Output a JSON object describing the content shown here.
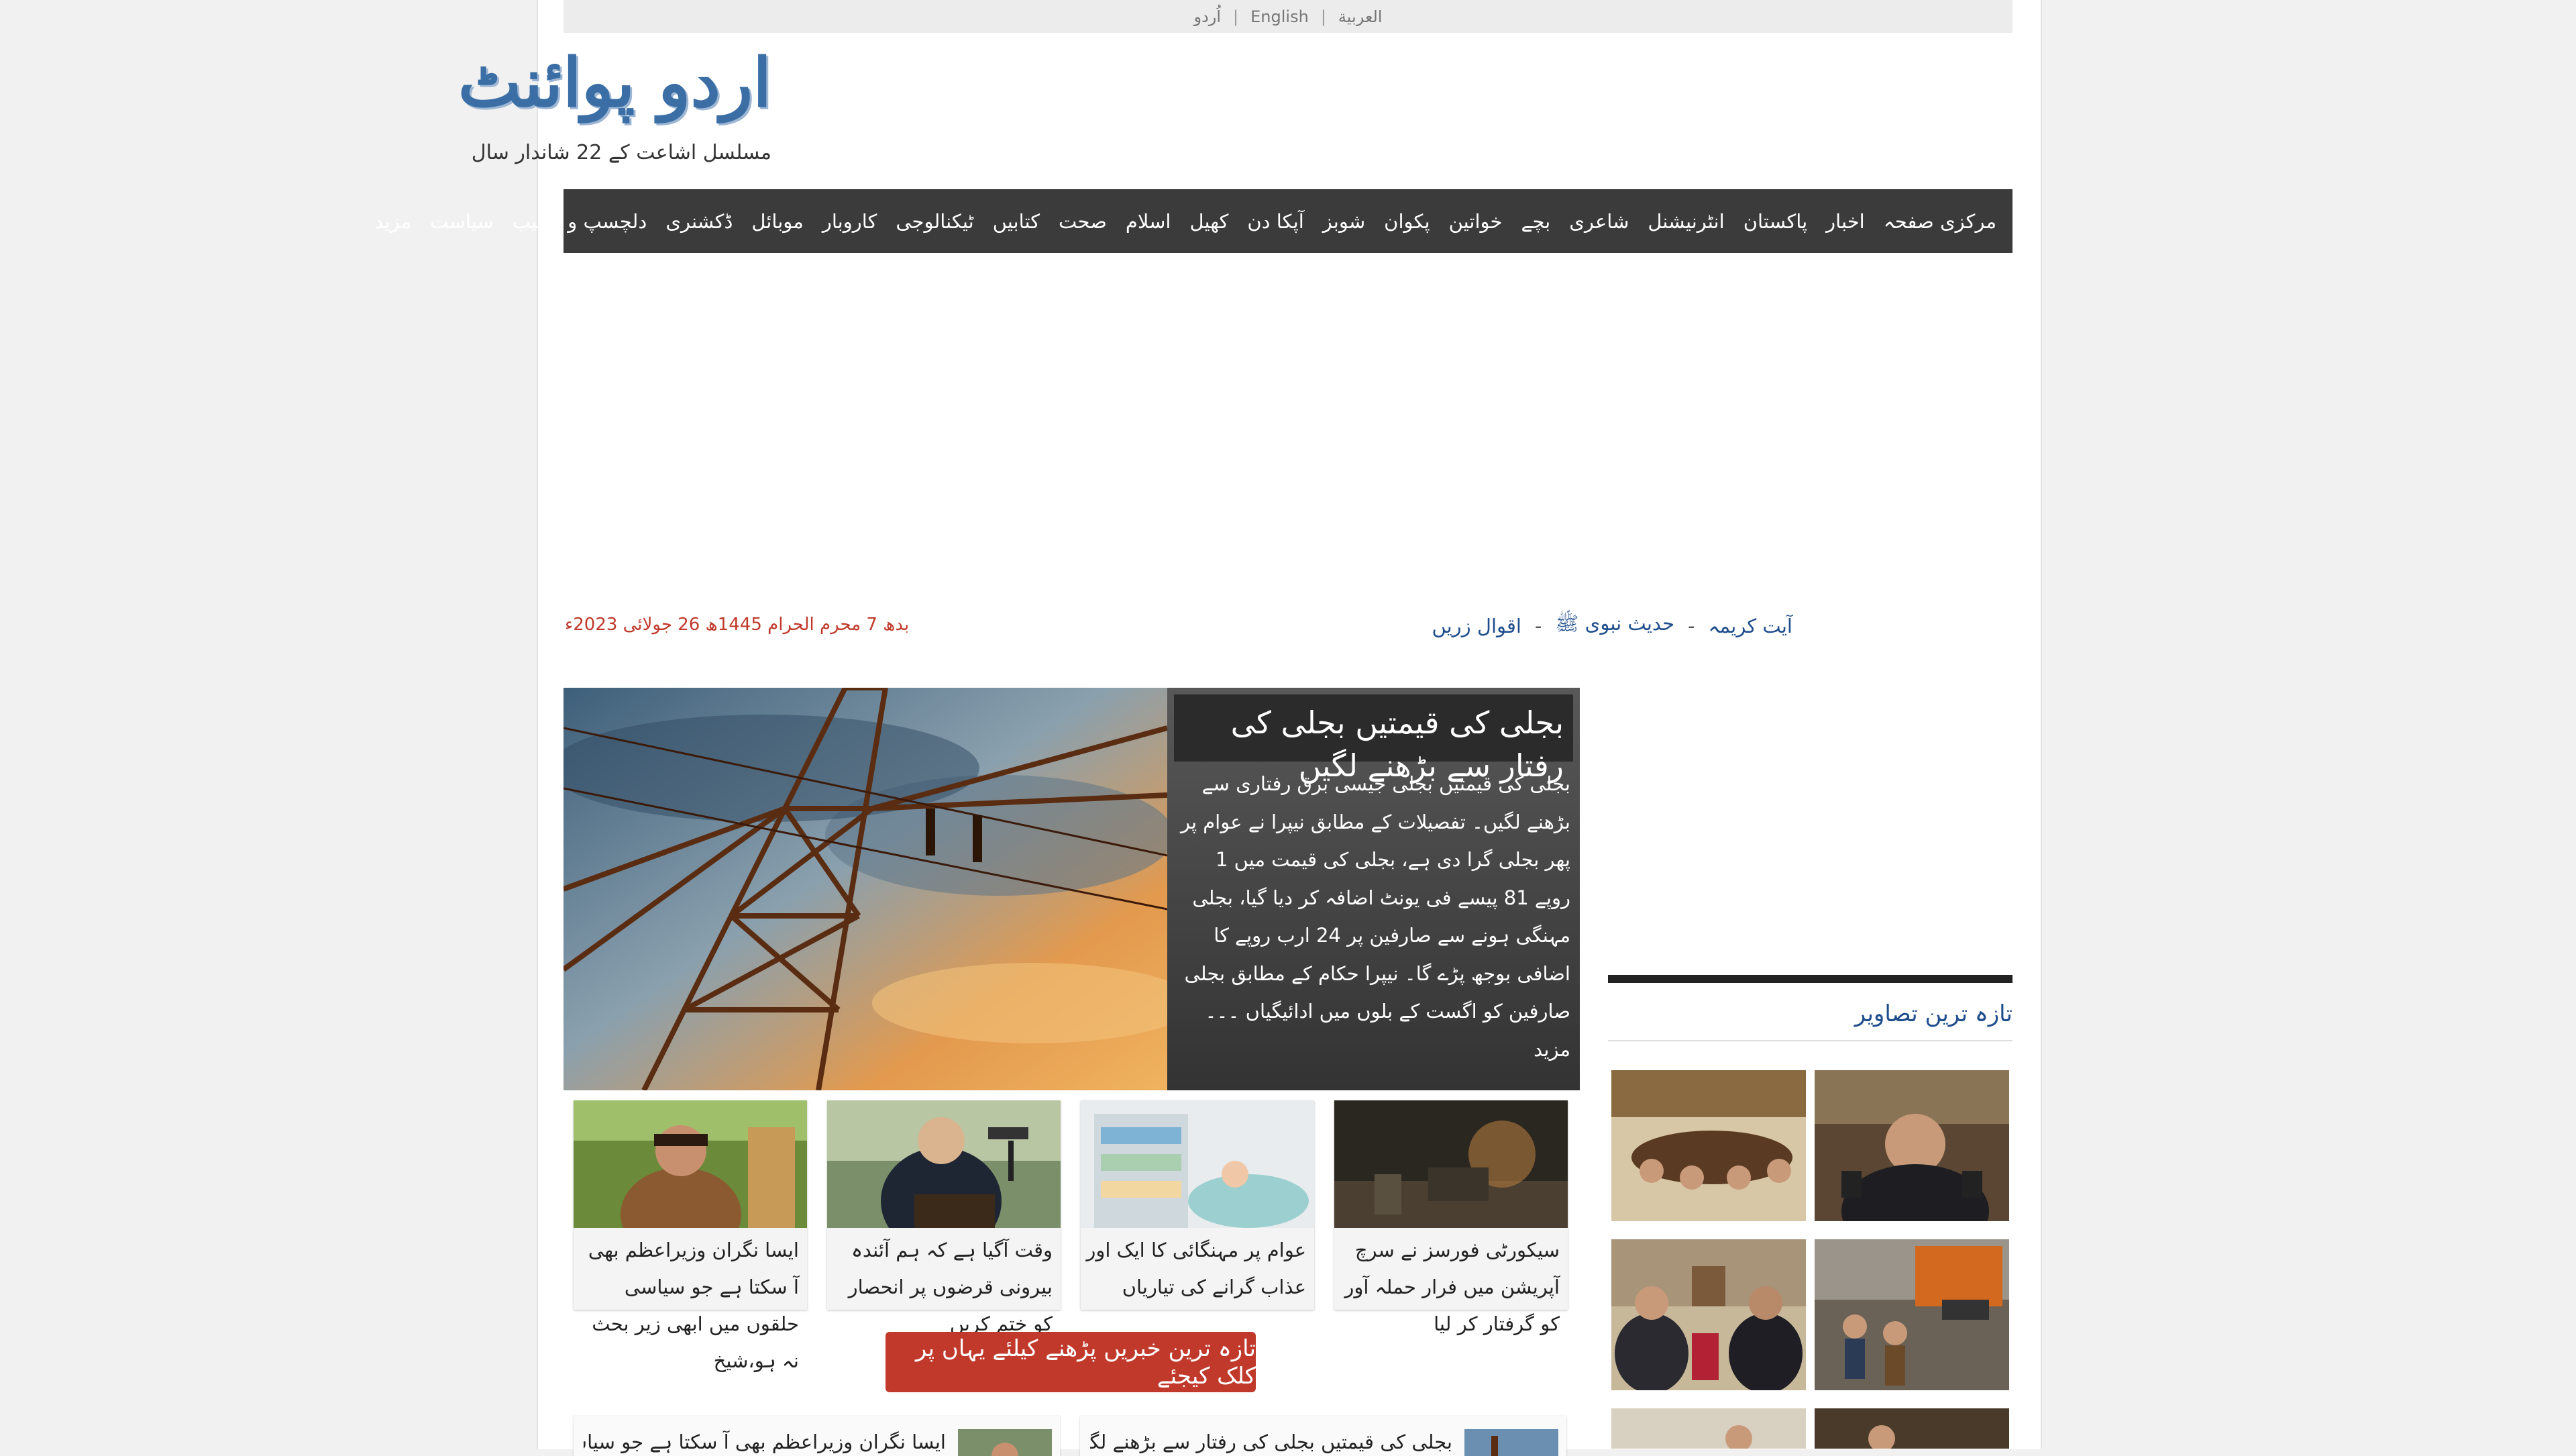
{
  "lang_bar": {
    "urdu": "اُردو",
    "english": "English",
    "arabic": "العربية",
    "sep": "|"
  },
  "logo": {
    "name": "اردو پوائنٹ",
    "tagline": "مسلسل اشاعت کے 22 شاندار سال"
  },
  "nav": {
    "items": [
      "مرکزی صفحہ",
      "اخبار",
      "پاکستان",
      "انٹرنیشنل",
      "شاعری",
      "بچے",
      "خواتین",
      "پکوان",
      "شوبز",
      "آپکا دن",
      "کھیل",
      "اسلام",
      "صحت",
      "کتابیں",
      "ٹیکنالوجی",
      "کاروبار",
      "موبائل",
      "ڈکشنری",
      "دلچسپ و عجیب",
      "سیاست",
      "مزید"
    ]
  },
  "subnav": {
    "items": [
      "آیت کریمہ",
      "حدیث نبوی ﷺ",
      "اقوال زریں"
    ],
    "sep": "-"
  },
  "date": "بدھ 7 محرم الحرام 1445ھ 26 جولائی 2023ء",
  "hero": {
    "title": "بجلی کی قیمتیں بجلی کی رفتار سے بڑھنے لگیں",
    "body": "بجلی کی قیمتیں بجلی جیسی برق رفتاری سے بڑھنے لگیں۔ تفصیلات کے مطابق نیپرا نے عوام پر پھر بجلی گرا دی ہے، بجلی کی قیمت میں 1 روپے 81 پیسے فی یونٹ اضافہ کر دیا گیا، بجلی مہنگی ہونے سے صارفین پر 24 ارب روپے کا اضافی بوجھ پڑے گا۔ نیپرا حکام کے مطابق بجلی صارفین کو اگست کے بلوں میں ادائیگیاں ۔۔۔",
    "more": "مزید"
  },
  "cards": [
    {
      "caption": "سیکورٹی فورسز نے سرچ آپریشن میں فرار حملہ آور کو گرفتار کر لیا"
    },
    {
      "caption": "عوام پر مہنگائی کا ایک اور عذاب گرانے کی تیاریاں"
    },
    {
      "caption": "وقت آگیا ہے کہ ہم آئندہ بیرونی قرضوں پر انحصار کو ختم کریں"
    },
    {
      "caption": "ایسا نگران وزیراعظم بھی آ سکتا ہے جو سیاسی حلقوں میں ابھی زیر بحث نہ ہو،شیخ"
    }
  ],
  "more_news_button": "تازہ ترین خبریں پڑھنے کیلئے یہاں پر کلک کیجئے",
  "bottom_cards": [
    {
      "text": "بجلی کی قیمتیں بجلی کی رفتار سے بڑھنے لگیں"
    },
    {
      "text": "ایسا نگران وزیراعظم بھی آ سکتا ہے جو سیاسی حلقوں میں"
    }
  ],
  "sidebar": {
    "title": "تازہ ترین تصاویر"
  },
  "colors": {
    "nav_bg": "#3b3b3b",
    "accent_red": "#c0392b",
    "link_blue": "#1f4e8c"
  }
}
